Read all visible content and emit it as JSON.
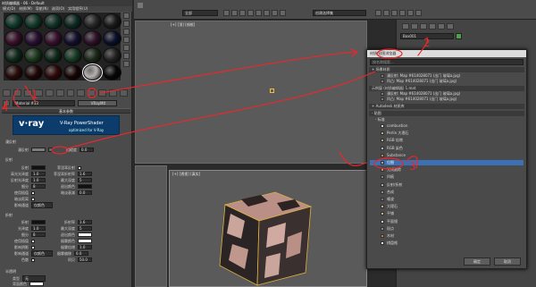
{
  "material_editor": {
    "title": "材质编辑器 - 06 - Default",
    "menu": [
      "模式(D)",
      "材质(M)",
      "导航(N)",
      "选项(O)",
      "实用程序(U)"
    ],
    "sample_colors": [
      "#0d3a2a",
      "#103a2a",
      "#0f3326",
      "#0c2a22",
      "#262626",
      "#1a1a1a",
      "#3a0f2a",
      "#2a0f35",
      "#3a1030",
      "#150f30",
      "#2f102a",
      "#0a0f2a",
      "#0e2a1a",
      "#1a3a1a",
      "#0e2818",
      "#153a22",
      "#1c2a18",
      "#222222",
      "#2a0a0a",
      "#200606",
      "#300808",
      "#180404",
      "#b7b0b0",
      "#070707"
    ],
    "material_name": "Material #33",
    "material_type": "VRayMtl",
    "basic_params_title": "基本参数",
    "vray_logo": "v·ray",
    "vray_shader": "V-Ray PowerShader",
    "vray_sub": "optimized for V-Ray",
    "diffuse_group": "漫反射",
    "diffuse_label": "漫反射",
    "roughness_label": "粗糙度",
    "roughness_value": "0.0",
    "reflection_group": "反射",
    "reflect_label": "反射",
    "hilight_gloss_label": "高光光泽度",
    "refl_gloss_label": "反射光泽度",
    "subdivs_label": "细分",
    "use_interp_label": "使用插值",
    "dim_distance_label": "暗淡距离",
    "affect_channels_label": "影响通道",
    "fresnel_label": "菲涅耳反射",
    "fresnel_ior_label": "菲涅耳折射率",
    "max_depth_label": "最大深度",
    "exit_color_label": "退出颜色",
    "dim_falloff_label": "暗淡衰减",
    "hilight_value": "1.0",
    "refl_gloss_value": "1.0",
    "subdivs_value": "8",
    "fresnel_ior_value": "1.6",
    "max_depth_value": "5",
    "dim_falloff_value": "0.0",
    "channels_value": "仅颜色",
    "refraction_group": "折射",
    "refract_label": "折射",
    "ior_label": "折射率",
    "gloss_label": "光泽度",
    "exit_color2_label": "退出颜色",
    "fog_color_label": "烟雾颜色",
    "fog_mult_label": "烟雾倍增",
    "fog_bias_label": "烟雾偏移",
    "affect_shadows_label": "影响阴影",
    "affect_channels2_label": "影响通道",
    "dispersion_label": "色散",
    "abbe_label": "阿贝",
    "ior_value": "1.6",
    "refr_gloss_value": "1.0",
    "refr_subdivs_value": "8",
    "refr_max_depth_value": "5",
    "fog_mult_value": "1.0",
    "fog_bias_value": "0.0",
    "abbe_value": "50.0",
    "channels2_value": "仅颜色",
    "translucency_group": "半透明",
    "type_label": "类型",
    "type_value": "无",
    "backside_label": "背面颜色"
  },
  "viewports": {
    "top_label": "[+] [顶] [线框]",
    "persp_label": "[+] [透视] [真实]"
  },
  "toolbar": {
    "selection_dropdown": "全部",
    "snap_dropdown": "创建选择集"
  },
  "command_panel": {
    "object_name": "Box001"
  },
  "browser": {
    "title": "材质/贴图浏览器",
    "search_hint": "按名称搜索...",
    "section_scene": "+ 场景材质",
    "scene_items": [
      "漫反射: Map #614028071 (出门 玻璃a.jpg)",
      "凹凸: Map #614028071 (出门 玻璃a.jpg)"
    ],
    "sample_line": "示例窗 (材质编辑器) 1.mat",
    "section_autodesk": "+ Autodesk 材质库",
    "section_maps": "- 贴图",
    "section_standard": "- 标准",
    "maps": [
      "combustion",
      "Perlin 大理石",
      "RGB 倍增",
      "RGB 染色",
      "Substance",
      "位图",
      "光线跟踪",
      "凹痕",
      "反射/折射",
      "合成",
      "噪波",
      "大理石",
      "平铺",
      "平面镜",
      "斑点",
      "木材",
      "棋盘格"
    ],
    "selected_index": 5,
    "ok": "确定",
    "cancel": "取消"
  },
  "annotations": {
    "color": "#e8282d",
    "labels": [
      "1",
      "2",
      "3",
      "4"
    ]
  }
}
